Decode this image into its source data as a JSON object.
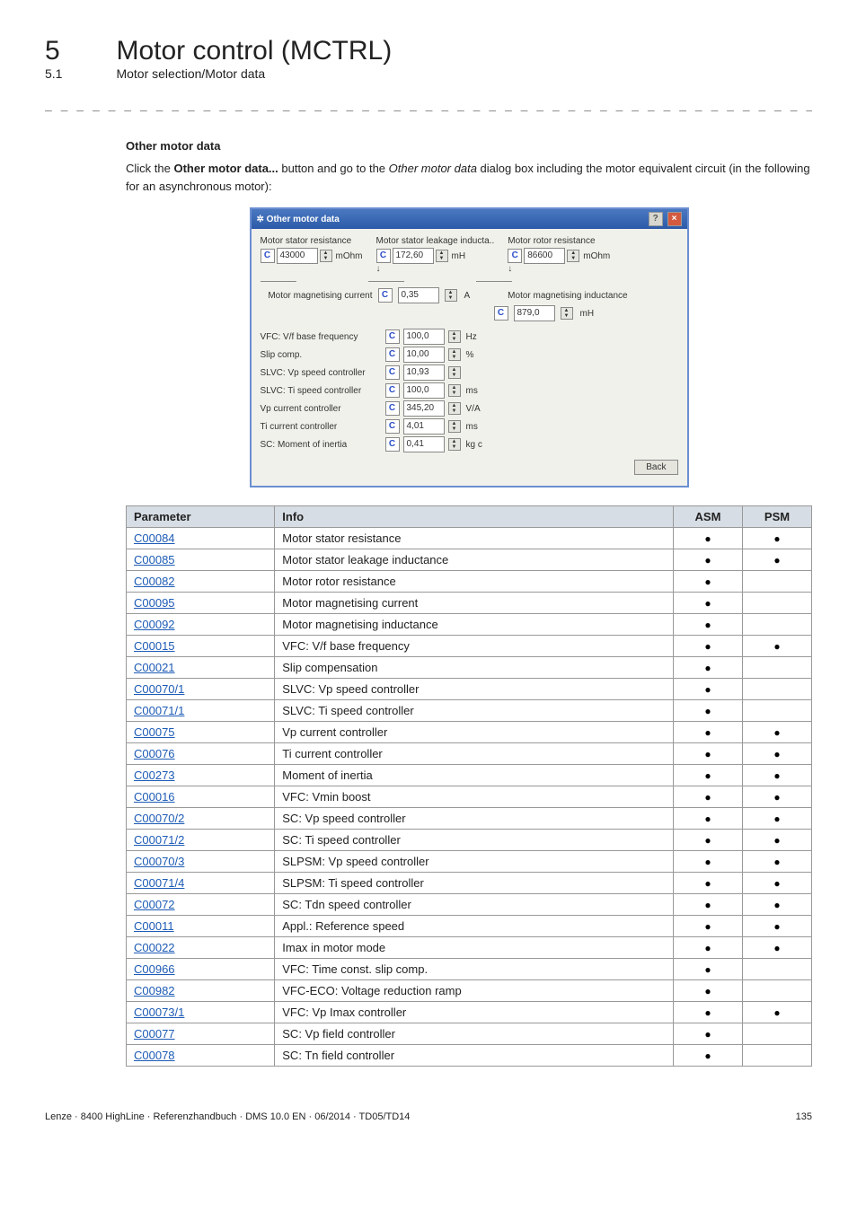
{
  "header": {
    "chapter_num": "5",
    "chapter_title": "Motor control (MCTRL)",
    "sub_num": "5.1",
    "sub_title": "Motor selection/Motor data"
  },
  "dashline": "_ _ _ _ _ _ _ _ _ _ _ _ _ _ _ _ _ _ _ _ _ _ _ _ _ _ _ _ _ _ _ _ _ _ _ _ _ _ _ _ _ _ _ _ _ _ _ _ _ _ _ _ _ _ _ _ _ _ _ _ _ _ _ _",
  "section_heading": "Other motor data",
  "para_parts": {
    "p1": "Click the ",
    "p2": "Other motor data...",
    "p3": " button and go to the ",
    "p4": "Other motor data",
    "p5": " dialog box including the motor equivalent circuit (in the following for an asynchronous motor):"
  },
  "dialog": {
    "title": "Other motor data",
    "help": "?",
    "close": "×",
    "c_label": "C",
    "stator_res": {
      "label": "Motor stator resistance",
      "val": "43000",
      "unit": "mOhm"
    },
    "leakage": {
      "label": "Motor stator leakage inducta..",
      "val": "172,60",
      "unit": "mH"
    },
    "rotor_res": {
      "label": "Motor rotor resistance",
      "val": "86600",
      "unit": "mOhm"
    },
    "mag_cur": {
      "label": "Motor magnetising current",
      "val": "0,35",
      "unit": "A"
    },
    "mag_ind": {
      "label": "Motor magnetising inductance",
      "val": "879,0",
      "unit": "mH"
    },
    "rows": [
      {
        "label": "VFC: V/f base frequency",
        "val": "100,0",
        "unit": "Hz"
      },
      {
        "label": "Slip comp.",
        "val": "10,00",
        "unit": "%"
      },
      {
        "label": "SLVC: Vp speed controller",
        "val": "10,93",
        "unit": ""
      },
      {
        "label": "SLVC: Ti speed controller",
        "val": "100,0",
        "unit": "ms"
      },
      {
        "label": "Vp current controller",
        "val": "345,20",
        "unit": "V/A"
      },
      {
        "label": "Ti current controller",
        "val": "4,01",
        "unit": "ms"
      },
      {
        "label": "SC: Moment of inertia",
        "val": "0,41",
        "unit": "kg c"
      }
    ],
    "back": "Back"
  },
  "table": {
    "headers": {
      "param": "Parameter",
      "info": "Info",
      "asm": "ASM",
      "psm": "PSM"
    },
    "rows": [
      {
        "p": "C00084",
        "i": "Motor stator resistance",
        "a": true,
        "s": true
      },
      {
        "p": "C00085",
        "i": "Motor stator leakage inductance",
        "a": true,
        "s": true
      },
      {
        "p": "C00082",
        "i": "Motor rotor resistance",
        "a": true,
        "s": false
      },
      {
        "p": "C00095",
        "i": "Motor magnetising current",
        "a": true,
        "s": false
      },
      {
        "p": "C00092",
        "i": "Motor magnetising inductance",
        "a": true,
        "s": false
      },
      {
        "p": "C00015",
        "i": "VFC: V/f base frequency",
        "a": true,
        "s": true
      },
      {
        "p": "C00021",
        "i": "Slip compensation",
        "a": true,
        "s": false
      },
      {
        "p": "C00070/1",
        "i": "SLVC: Vp speed controller",
        "a": true,
        "s": false
      },
      {
        "p": "C00071/1",
        "i": "SLVC: Ti speed controller",
        "a": true,
        "s": false
      },
      {
        "p": "C00075",
        "i": "Vp current controller",
        "a": true,
        "s": true
      },
      {
        "p": "C00076",
        "i": "Ti current controller",
        "a": true,
        "s": true
      },
      {
        "p": "C00273",
        "i": "Moment of inertia",
        "a": true,
        "s": true
      },
      {
        "p": "C00016",
        "i": "VFC: Vmin boost",
        "a": true,
        "s": true
      },
      {
        "p": "C00070/2",
        "i": "SC: Vp speed controller",
        "a": true,
        "s": true
      },
      {
        "p": "C00071/2",
        "i": "SC: Ti speed controller",
        "a": true,
        "s": true
      },
      {
        "p": "C00070/3",
        "i": "SLPSM: Vp speed controller",
        "a": true,
        "s": true
      },
      {
        "p": "C00071/4",
        "i": "SLPSM: Ti speed controller",
        "a": true,
        "s": true
      },
      {
        "p": "C00072",
        "i": "SC: Tdn speed controller",
        "a": true,
        "s": true
      },
      {
        "p": "C00011",
        "i": "Appl.: Reference speed",
        "a": true,
        "s": true
      },
      {
        "p": "C00022",
        "i": "Imax in motor mode",
        "a": true,
        "s": true
      },
      {
        "p": "C00966",
        "i": "VFC: Time const. slip comp.",
        "a": true,
        "s": false
      },
      {
        "p": "C00982",
        "i": "VFC-ECO: Voltage reduction ramp",
        "a": true,
        "s": false
      },
      {
        "p": "C00073/1",
        "i": "VFC: Vp Imax controller",
        "a": true,
        "s": true
      },
      {
        "p": "C00077",
        "i": "SC: Vp field controller",
        "a": true,
        "s": false
      },
      {
        "p": "C00078",
        "i": "SC: Tn field controller",
        "a": true,
        "s": false
      }
    ]
  },
  "footer": {
    "left": "Lenze · 8400 HighLine · Referenzhandbuch · DMS 10.0 EN · 06/2014 · TD05/TD14",
    "right": "135"
  }
}
